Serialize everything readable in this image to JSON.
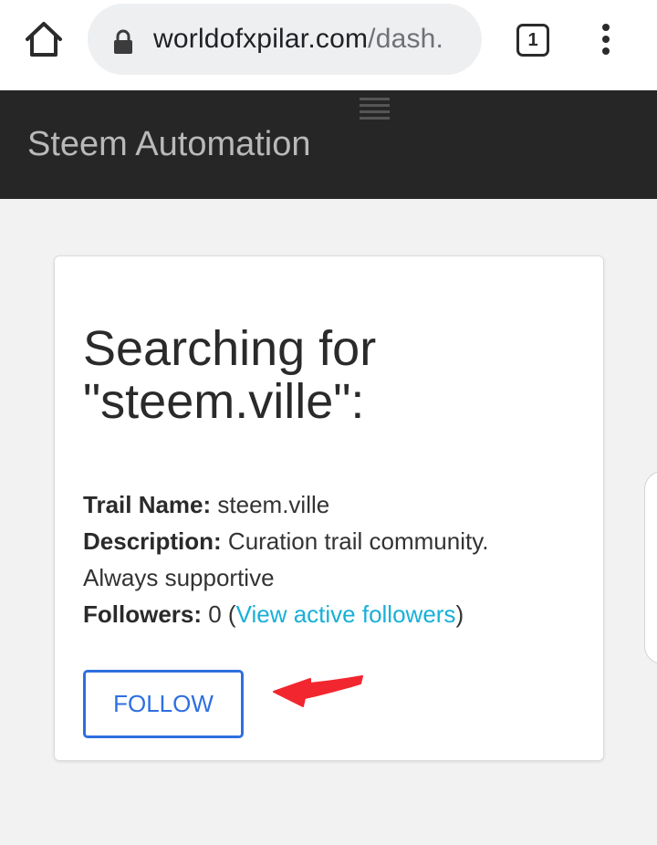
{
  "browser": {
    "url_domain": "worldofxpilar.com",
    "url_path": "/dash.",
    "tab_count": "1",
    "icons": {
      "home": "home-icon",
      "lock": "lock-icon",
      "menu": "more-vert-icon"
    }
  },
  "header": {
    "title": "Steem Automation",
    "menu_icon": "hamburger-icon"
  },
  "search": {
    "heading": "Searching for \"steem.ville\":",
    "trail_name_label": "Trail Name:",
    "trail_name_value": " steem.ville",
    "description_label": "Description:",
    "description_value": " Curation trail community. Always supportive",
    "followers_label": "Followers:",
    "followers_count": " 0 (",
    "followers_link": "View active followers",
    "followers_close": ")",
    "follow_button": "FOLLOW"
  },
  "colors": {
    "header_bg": "#262626",
    "link": "#17b0d8",
    "button": "#2e6fe0",
    "annotation_arrow": "#f2262e"
  }
}
